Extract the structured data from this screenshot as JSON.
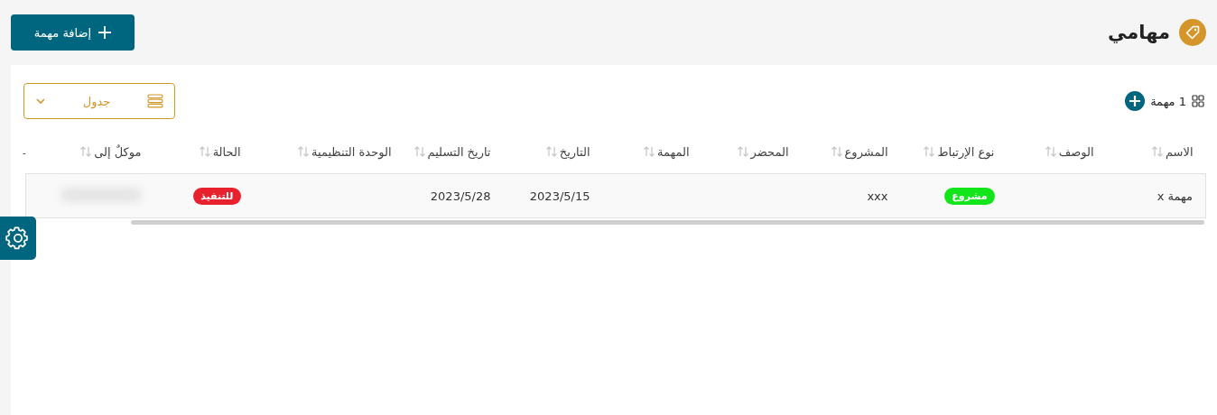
{
  "page": {
    "title": "مهامي",
    "add_button": "إضافة مهمة"
  },
  "toolbar": {
    "count": "1 مهمة",
    "view_select": "جدول"
  },
  "table": {
    "columns": [
      {
        "label": "الاسم"
      },
      {
        "label": "الوصف"
      },
      {
        "label": "نوع الإرتباط"
      },
      {
        "label": "المشروع"
      },
      {
        "label": "المحضر"
      },
      {
        "label": "المهمة"
      },
      {
        "label": "التاريخ"
      },
      {
        "label": "تاريخ التسليم"
      },
      {
        "label": "الوحدة التنظيمية"
      },
      {
        "label": "الحالة"
      },
      {
        "label": "موكلٌ إلى"
      }
    ],
    "extra_header": "-",
    "rows": [
      {
        "cells": [
          {
            "kind": "text",
            "text": "مهمة x"
          },
          {
            "kind": "empty"
          },
          {
            "kind": "tag",
            "text": "مشروع",
            "color": "#12e51a"
          },
          {
            "kind": "text",
            "text": "xxx"
          },
          {
            "kind": "empty"
          },
          {
            "kind": "empty"
          },
          {
            "kind": "text",
            "text": "2023/5/15"
          },
          {
            "kind": "text",
            "text": "2023/5/28"
          },
          {
            "kind": "empty"
          },
          {
            "kind": "tag",
            "text": "للتنفيذ",
            "color": "#e8212f"
          },
          {
            "kind": "redacted"
          }
        ]
      }
    ]
  }
}
